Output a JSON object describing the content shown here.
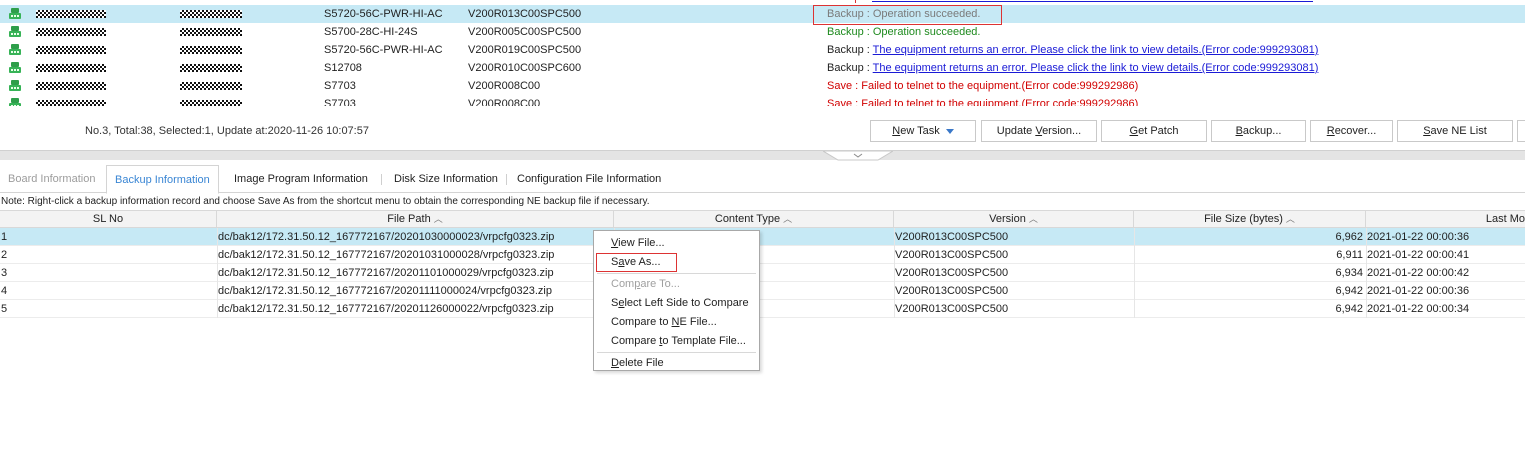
{
  "device_rows": [
    {
      "model": "S5720-56C-PWR-HI-AC",
      "version": "V200R013C00SPC500",
      "result_prefix": "Backup : ",
      "result_text": "Operation succeeded.",
      "result_kind": "ok-grey",
      "selected": true
    },
    {
      "model": "S5700-28C-HI-24S",
      "version": "V200R005C00SPC500",
      "result_prefix": "Backup : ",
      "result_text": "Operation succeeded.",
      "result_kind": "ok",
      "selected": false
    },
    {
      "model": "S5720-56C-PWR-HI-AC",
      "version": "V200R019C00SPC500",
      "result_prefix": "Backup : ",
      "result_text": "The equipment returns an error. Please click the link to view details.(Error code:999293081)",
      "result_kind": "link",
      "selected": false
    },
    {
      "model": "S12708",
      "version": "V200R010C00SPC600",
      "result_prefix": "Backup : ",
      "result_text": "The equipment returns an error. Please click the link to view details.(Error code:999293081)",
      "result_kind": "link",
      "selected": false
    },
    {
      "model": "S7703",
      "version": "V200R008C00",
      "result_prefix": "",
      "result_text": "Save : Failed to telnet to the equipment.(Error code:999292986)",
      "result_kind": "err",
      "selected": false
    },
    {
      "model": "S7703",
      "version": "V200R008C00",
      "result_prefix": "",
      "result_text": "Save : Failed to telnet to the equipment.(Error code:999292986)",
      "result_kind": "err",
      "selected": false
    }
  ],
  "status_bar": "No.3, Total:38, Selected:1, Update at:2020-11-26 10:07:57",
  "toolbar": {
    "new_task": {
      "pre": "",
      "u": "N",
      "post": "ew Task"
    },
    "update_version": {
      "pre": "Update ",
      "u": "V",
      "post": "ersion..."
    },
    "get_patch": {
      "pre": "",
      "u": "G",
      "post": "et Patch"
    },
    "backup": {
      "pre": "",
      "u": "B",
      "post": "ackup..."
    },
    "recover": {
      "pre": "",
      "u": "R",
      "post": "ecover..."
    },
    "save_ne_list": {
      "pre": "",
      "u": "S",
      "post": "ave NE List"
    }
  },
  "tabs": [
    {
      "label": "Board Information",
      "state": "disabled"
    },
    {
      "label": "Backup Information",
      "state": "active"
    },
    {
      "label": "Image Program Information",
      "state": "normal"
    },
    {
      "label": "Disk Size Information",
      "state": "normal"
    },
    {
      "label": "Configuration File Information",
      "state": "normal"
    }
  ],
  "note": "Note: Right-click a backup information record and choose Save As from the shortcut menu to obtain the corresponding NE backup file if necessary.",
  "backup_table": {
    "columns": [
      "SL No",
      "File Path",
      "Content Type",
      "Version",
      "File Size (bytes)",
      "Last Mo"
    ],
    "sort_arrow": "︿",
    "rows": [
      {
        "sl": "1",
        "path": "dc/bak12/172.31.50.12_167772167/20201030000023/vrpcfg0323.zip",
        "version": "V200R013C00SPC500",
        "size": "6,962",
        "last": "2021-01-22 00:00:36",
        "selected": true
      },
      {
        "sl": "2",
        "path": "dc/bak12/172.31.50.12_167772167/20201031000028/vrpcfg0323.zip",
        "version": "V200R013C00SPC500",
        "size": "6,911",
        "last": "2021-01-22 00:00:41",
        "selected": false
      },
      {
        "sl": "3",
        "path": "dc/bak12/172.31.50.12_167772167/20201101000029/vrpcfg0323.zip",
        "version": "V200R013C00SPC500",
        "size": "6,934",
        "last": "2021-01-22 00:00:42",
        "selected": false
      },
      {
        "sl": "4",
        "path": "dc/bak12/172.31.50.12_167772167/20201111000024/vrpcfg0323.zip",
        "version": "V200R013C00SPC500",
        "size": "6,942",
        "last": "2021-01-22 00:00:36",
        "selected": false
      },
      {
        "sl": "5",
        "path": "dc/bak12/172.31.50.12_167772167/20201126000022/vrpcfg0323.zip",
        "version": "V200R013C00SPC500",
        "size": "6,942",
        "last": "2021-01-22 00:00:34",
        "selected": false
      }
    ]
  },
  "context_menu": {
    "view_file": {
      "pre": "",
      "u": "V",
      "post": "iew File..."
    },
    "save_as": {
      "pre": "S",
      "u": "a",
      "post": "ve As..."
    },
    "compare_to": {
      "pre": "Com",
      "u": "p",
      "post": "are To..."
    },
    "select_left": {
      "pre": "S",
      "u": "e",
      "post": "lect Left Side to Compare"
    },
    "compare_ne": {
      "pre": "Compare to ",
      "u": "N",
      "post": "E File..."
    },
    "compare_template": {
      "pre": "Compare ",
      "u": "t",
      "post": "o Template File..."
    },
    "delete_file": {
      "pre": "",
      "u": "D",
      "post": "elete File"
    }
  },
  "colors": {
    "selected_row": "#c6e9f5",
    "active_tab": "#3a86d4",
    "error": "#d10000",
    "success": "#1e8a1e",
    "link": "#1a1ad6",
    "highlight_box": "#dd3333"
  },
  "icons": {
    "device": "switch-device-icon",
    "dropdown": "caret-down-icon",
    "splitter": "chevron-down-icon"
  }
}
